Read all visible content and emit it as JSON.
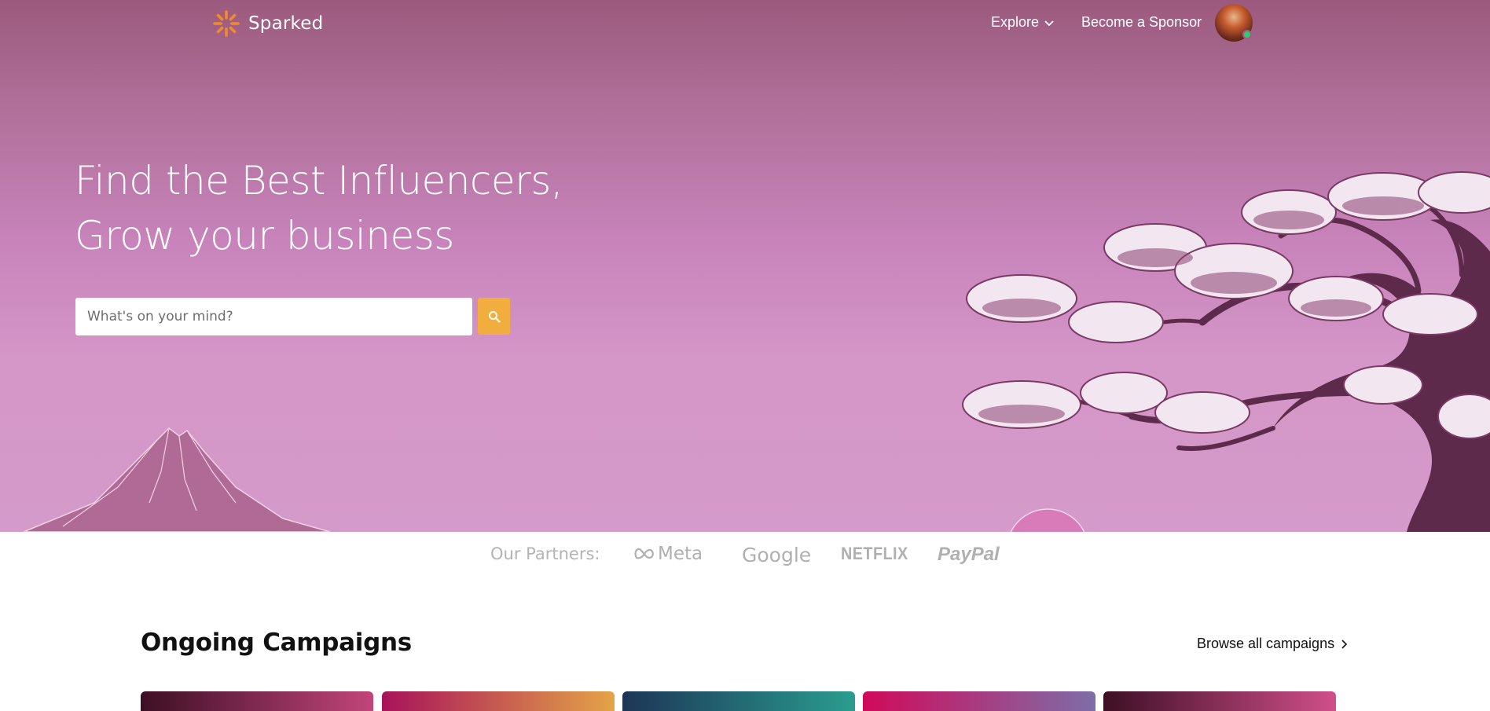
{
  "brand": {
    "name": "Sparked",
    "logo_icon": "spark-icon",
    "logo_color": "#f28a2b"
  },
  "nav": {
    "explore_label": "Explore",
    "explore_icon": "chevron-down-icon",
    "sponsor_label": "Become a Sponsor",
    "avatar_status_color": "#2ecc71"
  },
  "hero": {
    "headline_line1": "Find the Best Influencers,",
    "headline_line2": "Grow your business",
    "search": {
      "placeholder": "What's on your mind?",
      "value": "",
      "button_icon": "search-icon",
      "button_color": "#f2ad3f"
    }
  },
  "partners": {
    "label": "Our Partners:",
    "logos": [
      "Meta",
      "Google",
      "NETFLIX",
      "PayPal"
    ]
  },
  "campaigns": {
    "title": "Ongoing Campaigns",
    "browse_label": "Browse all campaigns",
    "browse_icon": "chevron-right-icon",
    "cards": [
      {
        "name": "campaign-card-1",
        "gradient": [
          "#3d0f24",
          "#c2457a"
        ]
      },
      {
        "name": "campaign-card-2",
        "gradient": [
          "#a8125a",
          "#e4a447"
        ]
      },
      {
        "name": "campaign-card-3",
        "gradient": [
          "#1d3557",
          "#2a9d8f"
        ]
      },
      {
        "name": "campaign-card-4",
        "gradient": [
          "#d10a5a",
          "#7d6ea8"
        ]
      },
      {
        "name": "campaign-card-5",
        "gradient": [
          "#3d0f24",
          "#d14f8a"
        ]
      }
    ]
  }
}
